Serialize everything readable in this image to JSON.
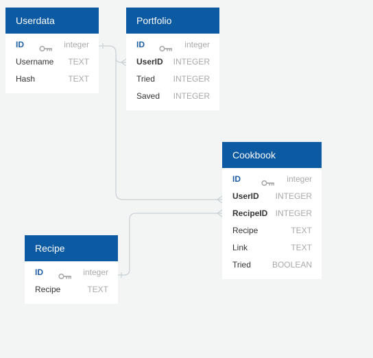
{
  "tables": [
    {
      "id": "userdata",
      "title": "Userdata",
      "fields": [
        {
          "name": "ID",
          "type": "integer",
          "primary_key": true,
          "key_icon": "key-icon"
        },
        {
          "name": "Username",
          "type": "TEXT"
        },
        {
          "name": "Hash",
          "type": "TEXT"
        }
      ]
    },
    {
      "id": "portfolio",
      "title": "Portfolio",
      "fields": [
        {
          "name": "ID",
          "type": "integer",
          "primary_key": true,
          "key_icon": "key-icon"
        },
        {
          "name": "UserID",
          "type": "INTEGER",
          "foreign_key": true
        },
        {
          "name": "Tried",
          "type": "INTEGER"
        },
        {
          "name": "Saved",
          "type": "INTEGER"
        }
      ]
    },
    {
      "id": "cookbook",
      "title": "Cookbook",
      "fields": [
        {
          "name": "ID",
          "type": "integer",
          "primary_key": true,
          "key_icon": "key-icon"
        },
        {
          "name": "UserID",
          "type": "INTEGER",
          "foreign_key": true
        },
        {
          "name": "RecipeID",
          "type": "INTEGER",
          "foreign_key": true
        },
        {
          "name": "Recipe",
          "type": "TEXT"
        },
        {
          "name": "Link",
          "type": "TEXT"
        },
        {
          "name": "Tried",
          "type": "BOOLEAN"
        }
      ]
    },
    {
      "id": "recipe",
      "title": "Recipe",
      "fields": [
        {
          "name": "ID",
          "type": "integer",
          "primary_key": true,
          "key_icon": "key-icon"
        },
        {
          "name": "Recipe",
          "type": "TEXT"
        }
      ]
    }
  ],
  "relationships": [
    {
      "from": "Userdata.ID",
      "to": "Portfolio.UserID",
      "cardinality": "one-to-many"
    },
    {
      "from": "Userdata.ID",
      "to": "Cookbook.UserID",
      "cardinality": "one-to-many"
    },
    {
      "from": "Recipe.ID",
      "to": "Cookbook.RecipeID",
      "cardinality": "one-to-many"
    }
  ],
  "colors": {
    "header": "#0b5aa2",
    "header_text": "#ffffff",
    "primary_key_text": "#1c5fa5",
    "type_text": "#a9a9a9",
    "connector": "#c8cfd3",
    "background": "#f3f5f5"
  }
}
